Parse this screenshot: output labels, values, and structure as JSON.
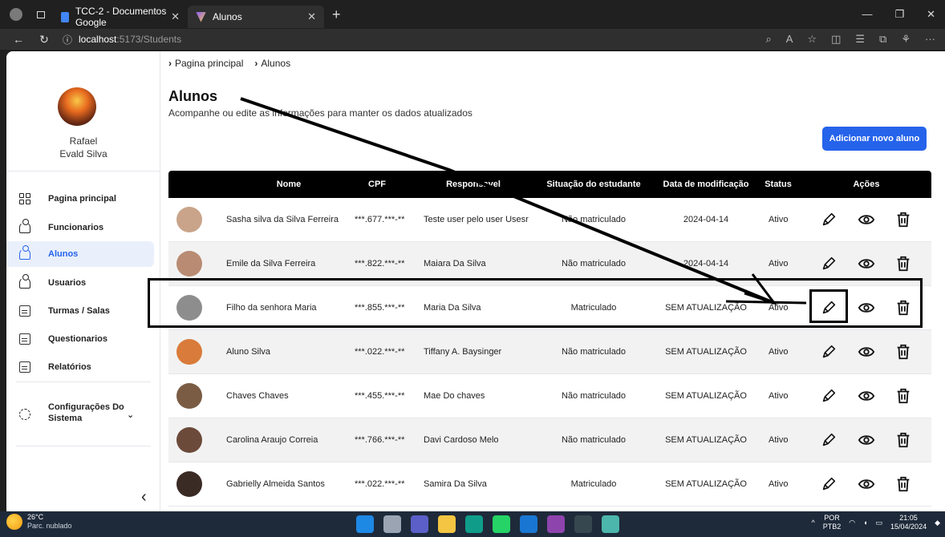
{
  "browser": {
    "tabs": [
      {
        "title": "TCC-2 - Documentos Google"
      },
      {
        "title": "Alunos"
      }
    ],
    "address": {
      "host": "localhost",
      "path": ":5173/Students"
    }
  },
  "sidebar": {
    "user_first": "Rafael",
    "user_last": "Evald Silva",
    "items": [
      {
        "label": "Pagina principal"
      },
      {
        "label": "Funcionarios"
      },
      {
        "label": "Alunos"
      },
      {
        "label": "Usuarios"
      },
      {
        "label": "Turmas / Salas"
      },
      {
        "label": "Questionarios"
      },
      {
        "label": "Relatórios"
      }
    ],
    "settings_line1": "Configurações Do",
    "settings_line2": "Sistema"
  },
  "breadcrumb": [
    "Pagina principal",
    "Alunos"
  ],
  "page": {
    "title": "Alunos",
    "subtitle": "Acompanhe ou edite as informações para manter os dados atualizados",
    "add_button": "Adicionar novo aluno"
  },
  "table": {
    "headers": [
      "Nome",
      "CPF",
      "Responsavel",
      "Situação do estudante",
      "Data de modificação",
      "Status",
      "Ações"
    ],
    "rows": [
      {
        "nome": "Sasha silva da Silva Ferreira",
        "cpf": "***.677.***-**",
        "resp": "Teste user pelo user Usesr",
        "situacao": "Não matriculado",
        "data": "2024-04-14",
        "status": "Ativo"
      },
      {
        "nome": "Emile da Silva Ferreira",
        "cpf": "***.822.***-**",
        "resp": "Maiara Da Silva",
        "situacao": "Não matriculado",
        "data": "2024-04-14",
        "status": "Ativo"
      },
      {
        "nome": "Filho da senhora Maria",
        "cpf": "***.855.***-**",
        "resp": "Maria Da Silva",
        "situacao": "Matriculado",
        "data": "SEM ATUALIZAÇÃO",
        "status": "Ativo"
      },
      {
        "nome": "Aluno Silva",
        "cpf": "***.022.***-**",
        "resp": "Tiffany A. Baysinger",
        "situacao": "Não matriculado",
        "data": "SEM ATUALIZAÇÃO",
        "status": "Ativo"
      },
      {
        "nome": "Chaves Chaves",
        "cpf": "***.455.***-**",
        "resp": "Mae Do chaves",
        "situacao": "Não matriculado",
        "data": "SEM ATUALIZAÇÃO",
        "status": "Ativo"
      },
      {
        "nome": "Carolina Araujo Correia",
        "cpf": "***.766.***-**",
        "resp": "Davi Cardoso Melo",
        "situacao": "Não matriculado",
        "data": "SEM ATUALIZAÇÃO",
        "status": "Ativo"
      },
      {
        "nome": "Gabrielly Almeida Santos",
        "cpf": "***.022.***-**",
        "resp": "Samira Da Silva",
        "situacao": "Matriculado",
        "data": "SEM ATUALIZAÇÃO",
        "status": "Ativo"
      }
    ]
  },
  "taskbar": {
    "temp": "26°C",
    "weather": "Parc. nublado",
    "lang1": "POR",
    "lang2": "PTB2",
    "time": "21:05",
    "date": "15/04/2024"
  },
  "colors": {
    "accent": "#2563eb",
    "header_bg": "#000000",
    "active_bg": "#eaf0fb"
  }
}
